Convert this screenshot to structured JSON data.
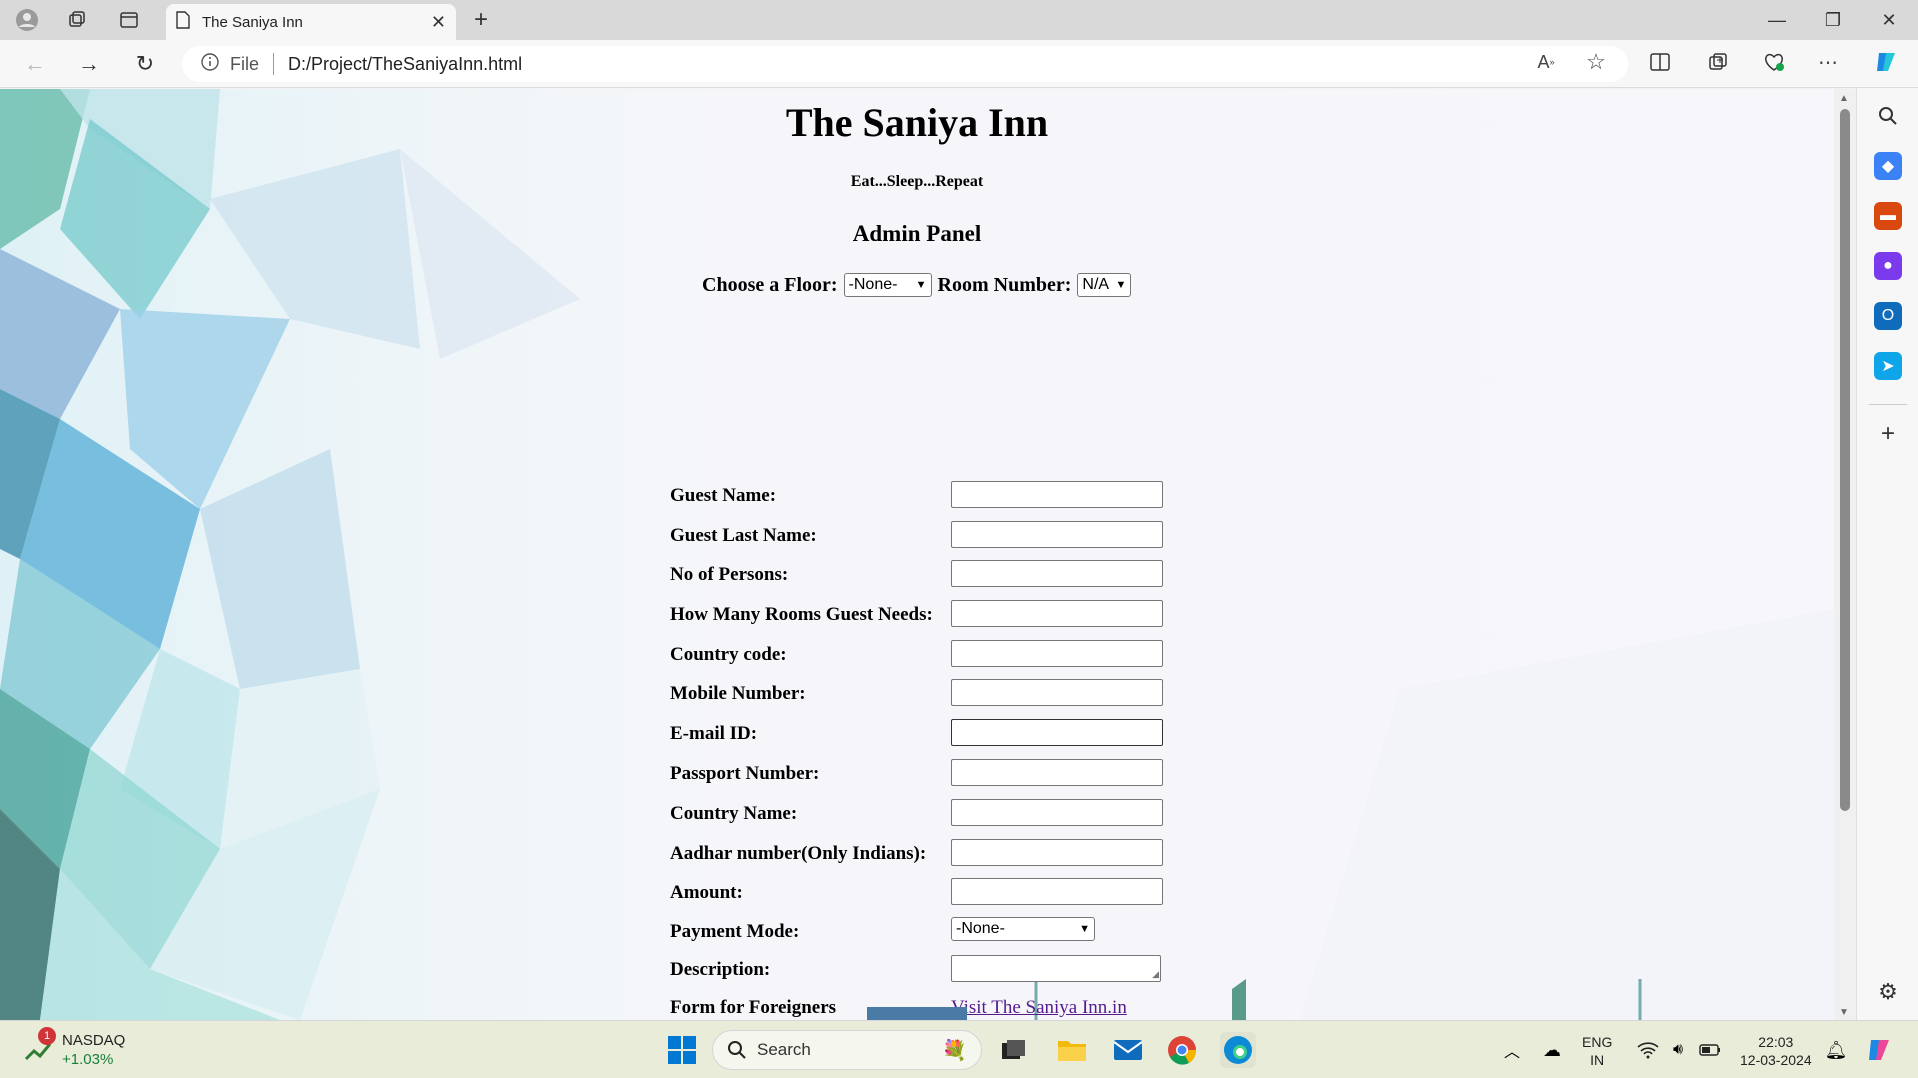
{
  "browser": {
    "tab_title": "The Saniya Inn",
    "address_file_label": "File",
    "address_url": "D:/Project/TheSaniyaInn.html"
  },
  "page": {
    "title": "The Saniya Inn",
    "tagline": "Eat...Sleep...Repeat",
    "panel_heading": "Admin Panel",
    "floor_label": "Choose a Floor:",
    "floor_value": "-None-",
    "room_label": "Room Number:",
    "room_value": "N/A"
  },
  "form": {
    "fields": [
      {
        "label": "Guest Name:"
      },
      {
        "label": "Guest Last Name:"
      },
      {
        "label": "No of Persons:"
      },
      {
        "label": "How Many Rooms Guest Needs:"
      },
      {
        "label": "Country code:"
      },
      {
        "label": "Mobile Number:"
      },
      {
        "label": "E-mail ID:"
      },
      {
        "label": "Passport Number:"
      },
      {
        "label": "Country Name:"
      },
      {
        "label": "Aadhar number(Only Indians):"
      },
      {
        "label": "Amount:"
      }
    ],
    "payment_label": "Payment Mode:",
    "payment_value": "-None-",
    "description_label": "Description:",
    "foreigners_label": "Form for Foreigners",
    "foreigners_link": "Visit The Saniya Inn.in"
  },
  "taskbar": {
    "stock_name": "NASDAQ",
    "stock_change": "+1.03%",
    "stock_badge": "1",
    "search_label": "Search",
    "lang_top": "ENG",
    "lang_bottom": "IN",
    "time": "22:03",
    "date": "12-03-2024"
  }
}
